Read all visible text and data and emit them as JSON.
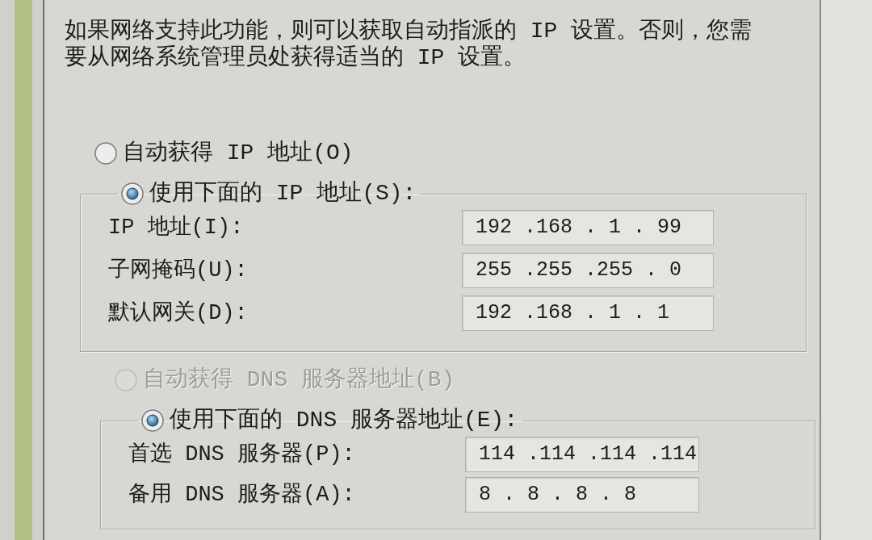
{
  "description": "如果网络支持此功能，则可以获取自动指派的 IP 设置。否则，您需要从网络系统管理员处获得适当的 IP 设置。",
  "ip_settings": {
    "options": [
      {
        "label": "自动获得 IP 地址(O)",
        "selected": false,
        "disabled": false
      },
      {
        "label": "使用下面的 IP 地址(S):",
        "selected": true,
        "disabled": false
      }
    ],
    "fields": [
      {
        "label": "IP 地址(I):",
        "value": "192 .168 . 1 . 99"
      },
      {
        "label": "子网掩码(U):",
        "value": "255 .255 .255 . 0"
      },
      {
        "label": "默认网关(D):",
        "value": "192 .168 . 1 . 1"
      }
    ]
  },
  "dns_settings": {
    "options": [
      {
        "label": "自动获得 DNS 服务器地址(B)",
        "selected": false,
        "disabled": true
      },
      {
        "label": "使用下面的 DNS 服务器地址(E):",
        "selected": true,
        "disabled": false
      }
    ],
    "fields": [
      {
        "label": "首选 DNS 服务器(P):",
        "value": "114 .114 .114 .114"
      },
      {
        "label": "备用 DNS 服务器(A):",
        "value": "8 . 8 . 8 . 8"
      }
    ]
  }
}
